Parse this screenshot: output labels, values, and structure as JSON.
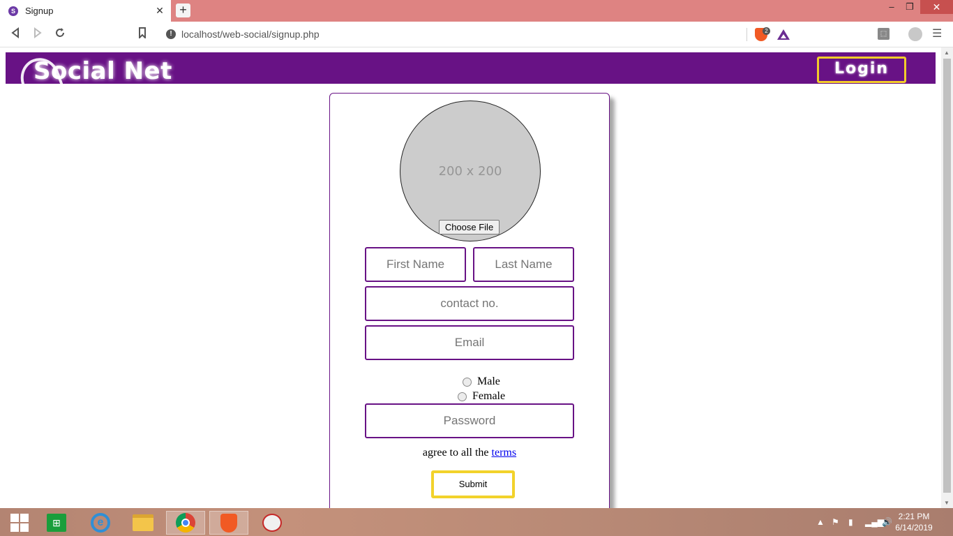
{
  "browser": {
    "tab_title": "Signup",
    "tab_favicon_letter": "S",
    "tab_close": "✕",
    "new_tab": "+",
    "url": "localhost/web-social/signup.php",
    "brave_shield_count": "2",
    "window": {
      "minimize": "–",
      "restore": "❐",
      "close": "✕"
    }
  },
  "site": {
    "logo_text": "Social Net",
    "login_button": "Login"
  },
  "form": {
    "avatar_placeholder": "200 x 200",
    "choose_file": "Choose File",
    "first_name_placeholder": "First Name",
    "last_name_placeholder": "Last Name",
    "contact_placeholder": "contact no.",
    "email_placeholder": "Email",
    "gender_options": [
      "Male",
      "Female"
    ],
    "password_placeholder": "Password",
    "terms_text": "agree to all the ",
    "terms_link": "terms",
    "submit": "Submit"
  },
  "taskbar": {
    "time": "2:21 PM",
    "date": "6/14/2019"
  },
  "colors": {
    "brand_purple": "#681285",
    "accent_yellow": "#f2cc2b",
    "tab_bar": "#de8382"
  }
}
